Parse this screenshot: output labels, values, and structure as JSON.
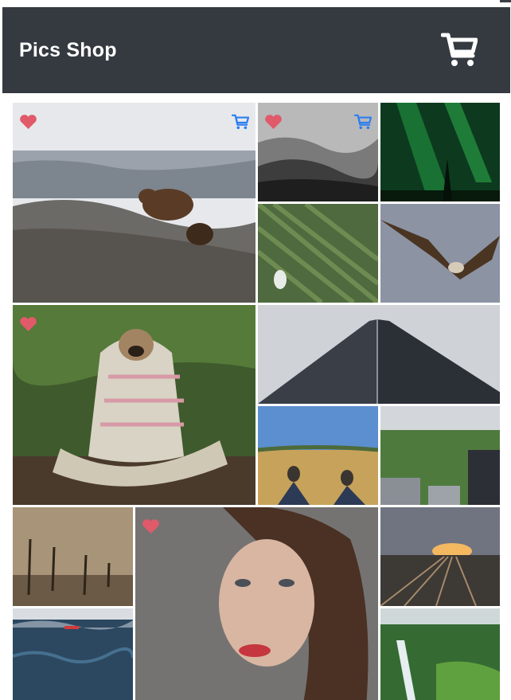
{
  "header": {
    "title": "Pics Shop",
    "cart_icon": "cart-icon"
  },
  "colors": {
    "header_bg": "#343a40",
    "heart": "#e05a6a",
    "cart_blue": "#2c7ef0"
  },
  "photos": [
    {
      "subject": "bear-cubs",
      "favorited": true,
      "in_cart": true
    },
    {
      "subject": "misty-forest",
      "favorited": true,
      "in_cart": true
    },
    {
      "subject": "aurora",
      "favorited": false,
      "in_cart": false
    },
    {
      "subject": "grass-bird",
      "favorited": false,
      "in_cart": false
    },
    {
      "subject": "eagle",
      "favorited": false,
      "in_cart": false
    },
    {
      "subject": "pug-blanket",
      "favorited": true,
      "in_cart": false
    },
    {
      "subject": "skyscraper",
      "favorited": false,
      "in_cart": false
    },
    {
      "subject": "field-shoes",
      "favorited": false,
      "in_cart": false
    },
    {
      "subject": "city-park",
      "favorited": false,
      "in_cart": false
    },
    {
      "subject": "dead-trees",
      "favorited": false,
      "in_cart": false
    },
    {
      "subject": "woman-portrait",
      "favorited": true,
      "in_cart": false
    },
    {
      "subject": "railway-sunset",
      "favorited": false,
      "in_cart": false
    },
    {
      "subject": "sea-boat",
      "favorited": false,
      "in_cart": false
    },
    {
      "subject": "waterfall",
      "favorited": false,
      "in_cart": false
    }
  ]
}
